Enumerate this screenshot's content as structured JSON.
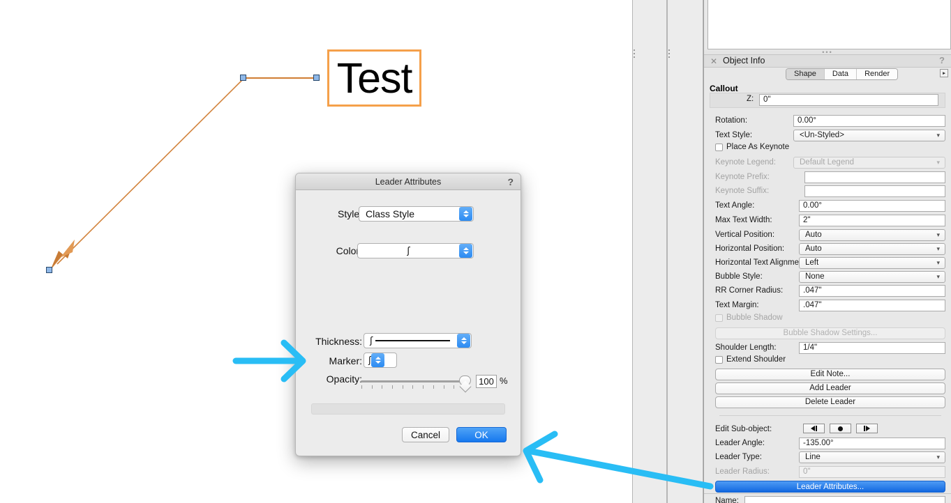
{
  "canvas": {
    "callout_text": "Test",
    "leader_color": "#D2833C",
    "callout_border_color": "#F5A04A",
    "handle_fill": "#8FB8E8"
  },
  "object_info": {
    "title": "Object Info",
    "close_icon": "close-icon",
    "help_icon": "?",
    "tabs": [
      {
        "label": "Shape",
        "active": true
      },
      {
        "label": "Data",
        "active": false
      },
      {
        "label": "Render",
        "active": false
      }
    ],
    "section_title": "Callout",
    "fields": {
      "z_label": "Z:",
      "z_value": "0\"",
      "rotation_label": "Rotation:",
      "rotation_value": "0.00°",
      "text_style_label": "Text Style:",
      "text_style_value": "<Un-Styled>",
      "place_as_keynote_label": "Place As Keynote",
      "keynote_legend_label": "Keynote Legend:",
      "keynote_legend_value": "Default Legend",
      "keynote_prefix_label": "Keynote Prefix:",
      "keynote_prefix_value": "",
      "keynote_suffix_label": "Keynote Suffix:",
      "keynote_suffix_value": "",
      "text_angle_label": "Text Angle:",
      "text_angle_value": "0.00°",
      "max_text_width_label": "Max Text Width:",
      "max_text_width_value": "2\"",
      "vertical_position_label": "Vertical Position:",
      "vertical_position_value": "Auto",
      "horizontal_position_label": "Horizontal Position:",
      "horizontal_position_value": "Auto",
      "horizontal_text_alignment_label": "Horizontal Text Alignment:",
      "horizontal_text_alignment_value": "Left",
      "bubble_style_label": "Bubble Style:",
      "bubble_style_value": "None",
      "rr_corner_radius_label": "RR Corner Radius:",
      "rr_corner_radius_value": ".047\"",
      "text_margin_label": "Text Margin:",
      "text_margin_value": ".047\"",
      "bubble_shadow_label": "Bubble Shadow",
      "bubble_shadow_settings_label": "Bubble Shadow Settings...",
      "shoulder_length_label": "Shoulder Length:",
      "shoulder_length_value": "1/4\"",
      "extend_shoulder_label": "Extend Shoulder",
      "edit_note_label": "Edit Note...",
      "add_leader_label": "Add Leader",
      "delete_leader_label": "Delete Leader",
      "edit_subobject_label": "Edit Sub-object:",
      "leader_angle_label": "Leader Angle:",
      "leader_angle_value": "-135.00°",
      "leader_type_label": "Leader Type:",
      "leader_type_value": "Line",
      "leader_radius_label": "Leader Radius:",
      "leader_radius_value": "0\"",
      "leader_attributes_label": "Leader Attributes...",
      "name_label": "Name:",
      "name_value": ""
    },
    "accent_blue": "#1268E0"
  },
  "dialog": {
    "title": "Leader Attributes",
    "help_icon": "?",
    "style_label": "Style:",
    "style_value": "Class Style",
    "color_label": "Color:",
    "color_value": "ʃ",
    "thickness_label": "Thickness:",
    "thickness_value": "ʃ",
    "marker_label": "Marker:",
    "marker_value": "ʃ",
    "opacity_label": "Opacity:",
    "opacity_value": "100",
    "opacity_unit": "%",
    "cancel_label": "Cancel",
    "ok_label": "OK",
    "ok_color": "#1678EE"
  },
  "annotations": {
    "arrow_color": "#29BDF5",
    "arrow_1": "points-at-marker-row",
    "arrow_2": "points-from-leader-attributes-button-to-dialog"
  }
}
